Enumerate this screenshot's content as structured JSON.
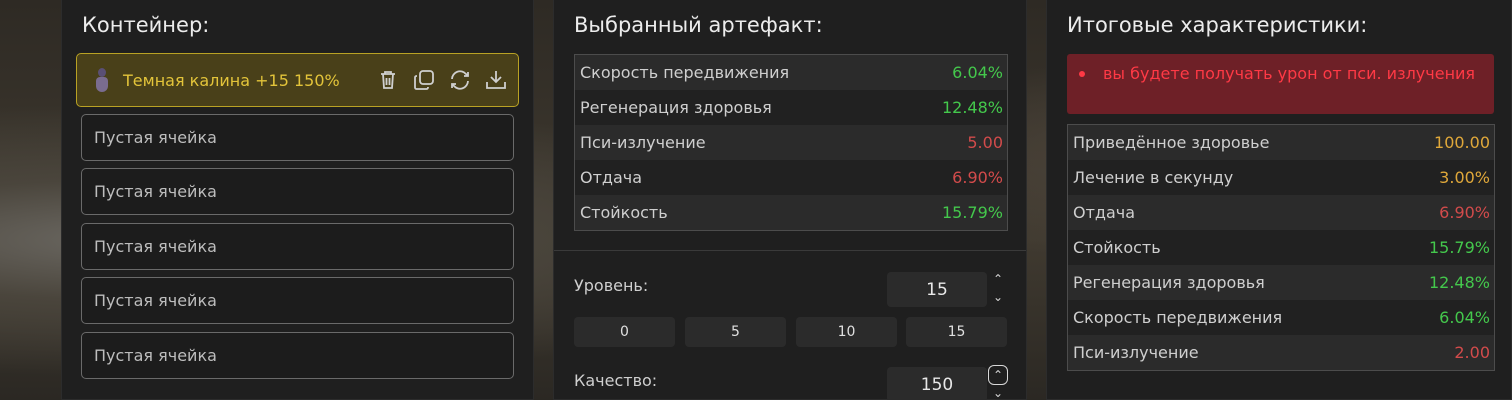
{
  "container": {
    "title": "Контейнер:",
    "active_slot": {
      "icon": "artifact-icon",
      "name": "Темная калина +15 150%",
      "actions": [
        "trash-icon",
        "copy-icon",
        "refresh-icon",
        "download-icon"
      ]
    },
    "empty_slots": [
      "Пустая ячейка",
      "Пустая ячейка",
      "Пустая ячейка",
      "Пустая ячейка",
      "Пустая ячейка"
    ]
  },
  "artifact": {
    "title": "Выбранный артефакт:",
    "stats": [
      {
        "label": "Скорость передвижения",
        "value": "6.04%",
        "color": "#44c84c"
      },
      {
        "label": "Регенерация здоровья",
        "value": "12.48%",
        "color": "#44c84c"
      },
      {
        "label": "Пси-излучение",
        "value": "5.00",
        "color": "#d24b4b"
      },
      {
        "label": "Отдача",
        "value": "6.90%",
        "color": "#d24b4b"
      },
      {
        "label": "Стойкость",
        "value": "15.79%",
        "color": "#44c84c"
      }
    ],
    "level_label": "Уровень:",
    "level_value": "15",
    "quick_levels": [
      "0",
      "5",
      "10",
      "15"
    ],
    "quality_label": "Качество:",
    "quality_value": "150"
  },
  "totals": {
    "title": "Итоговые характеристики:",
    "warning": "вы будете получать урон от пси. излучения",
    "stats": [
      {
        "label": "Приведённое здоровье",
        "value": "100.00",
        "color": "#e0a83a"
      },
      {
        "label": "Лечение в секунду",
        "value": "3.00%",
        "color": "#e0a83a"
      },
      {
        "label": "Отдача",
        "value": "6.90%",
        "color": "#d24b4b"
      },
      {
        "label": "Стойкость",
        "value": "15.79%",
        "color": "#44c84c"
      },
      {
        "label": "Регенерация здоровья",
        "value": "12.48%",
        "color": "#44c84c"
      },
      {
        "label": "Скорость передвижения",
        "value": "6.04%",
        "color": "#44c84c"
      },
      {
        "label": "Пси-излучение",
        "value": "2.00",
        "color": "#d24b4b"
      }
    ]
  }
}
